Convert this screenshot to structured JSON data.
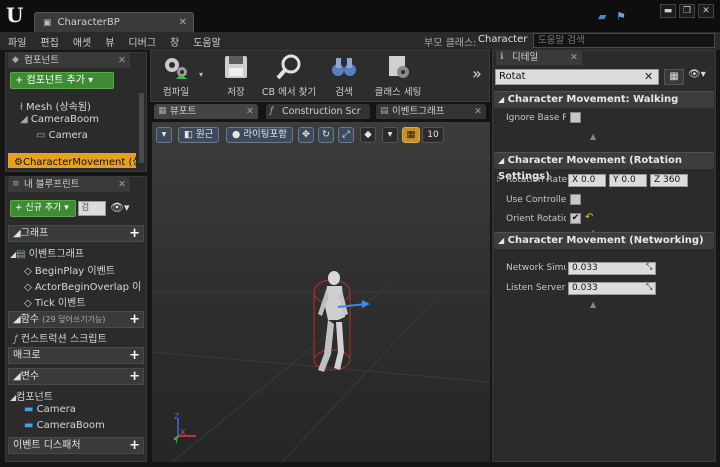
{
  "window": {
    "tab_title": "CharacterBP",
    "minimize": "▬",
    "restore": "❐",
    "close": "✕"
  },
  "menubar": {
    "items": [
      "파일",
      "편집",
      "애셋",
      "뷰",
      "디버그",
      "창",
      "도움말"
    ],
    "parent_class_label": "부모 클래스:",
    "parent_class_value": "Character",
    "help_search_placeholder": "도움말 검색"
  },
  "components_panel": {
    "tab_label": "컴포넌트",
    "add_button": "+ 컴포넌트 추가 ▾",
    "items": [
      "Mesh (상속됨)",
      "CameraBoom",
      "Camera",
      "CharacterMovement (상"
    ]
  },
  "blueprint_panel": {
    "tab_label": "내 블루프린트",
    "add_new_button": "+ 신규 추가 ▾",
    "search_placeholder": "검",
    "graph_section": "그래프",
    "event_graph": "이벤트그래프",
    "events": [
      "BeginPlay 이벤트",
      "ActorBeginOverlap 이",
      "Tick 이벤트"
    ],
    "functions_section": "함수",
    "functions_note": "(29 덮어쓰기가능)",
    "construction_script": "컨스트럭션 스크립트",
    "macros_section": "매크로",
    "variables_section": "변수",
    "components_group": "컴포넌트",
    "variables": [
      "Camera",
      "CameraBoom"
    ],
    "dispatchers_section": "이벤트 디스패처"
  },
  "toolbar": {
    "compile": "컴파일",
    "save": "저장",
    "find_in_cb": "CB 에서 찾기",
    "search": "검색",
    "class_settings": "클래스 세팅",
    "more": "»"
  },
  "editor_tabs": [
    "뷰포트",
    "Construction Scr",
    "이벤트그래프"
  ],
  "viewport": {
    "perspective_button": "원근",
    "lit_button": "라이팅포함",
    "grid_snap_value": "10",
    "axis_x": "X",
    "axis_y": "Y",
    "axis_z": "Z"
  },
  "details_panel": {
    "tab_label": "디테일",
    "search_value": "Rotat",
    "sections": [
      {
        "title": "Character Movement: Walking"
      },
      {
        "title": "Character Movement (Rotation Settings)"
      },
      {
        "title": "Character Movement (Networking)"
      }
    ],
    "ignore_base_rotation_label": "Ignore Base Ro",
    "rotation_rate_label": "Rotation Rate",
    "rotation_rate": {
      "x_label": "X",
      "x": "0.0",
      "y_label": "Y",
      "y": "0.0",
      "z_label": "Z",
      "z": "360"
    },
    "use_controller_label": "Use Controller",
    "orient_rotation_label": "Orient Rotation",
    "network_sim_label": "Network Simu",
    "network_sim_value": "0.033",
    "listen_server_label": "Listen Server",
    "listen_server_value": "0.033"
  },
  "colors": {
    "accent_green": "#3e8a35",
    "selection_orange": "#e8a020",
    "viewport_bg": "#3a3a3a"
  }
}
